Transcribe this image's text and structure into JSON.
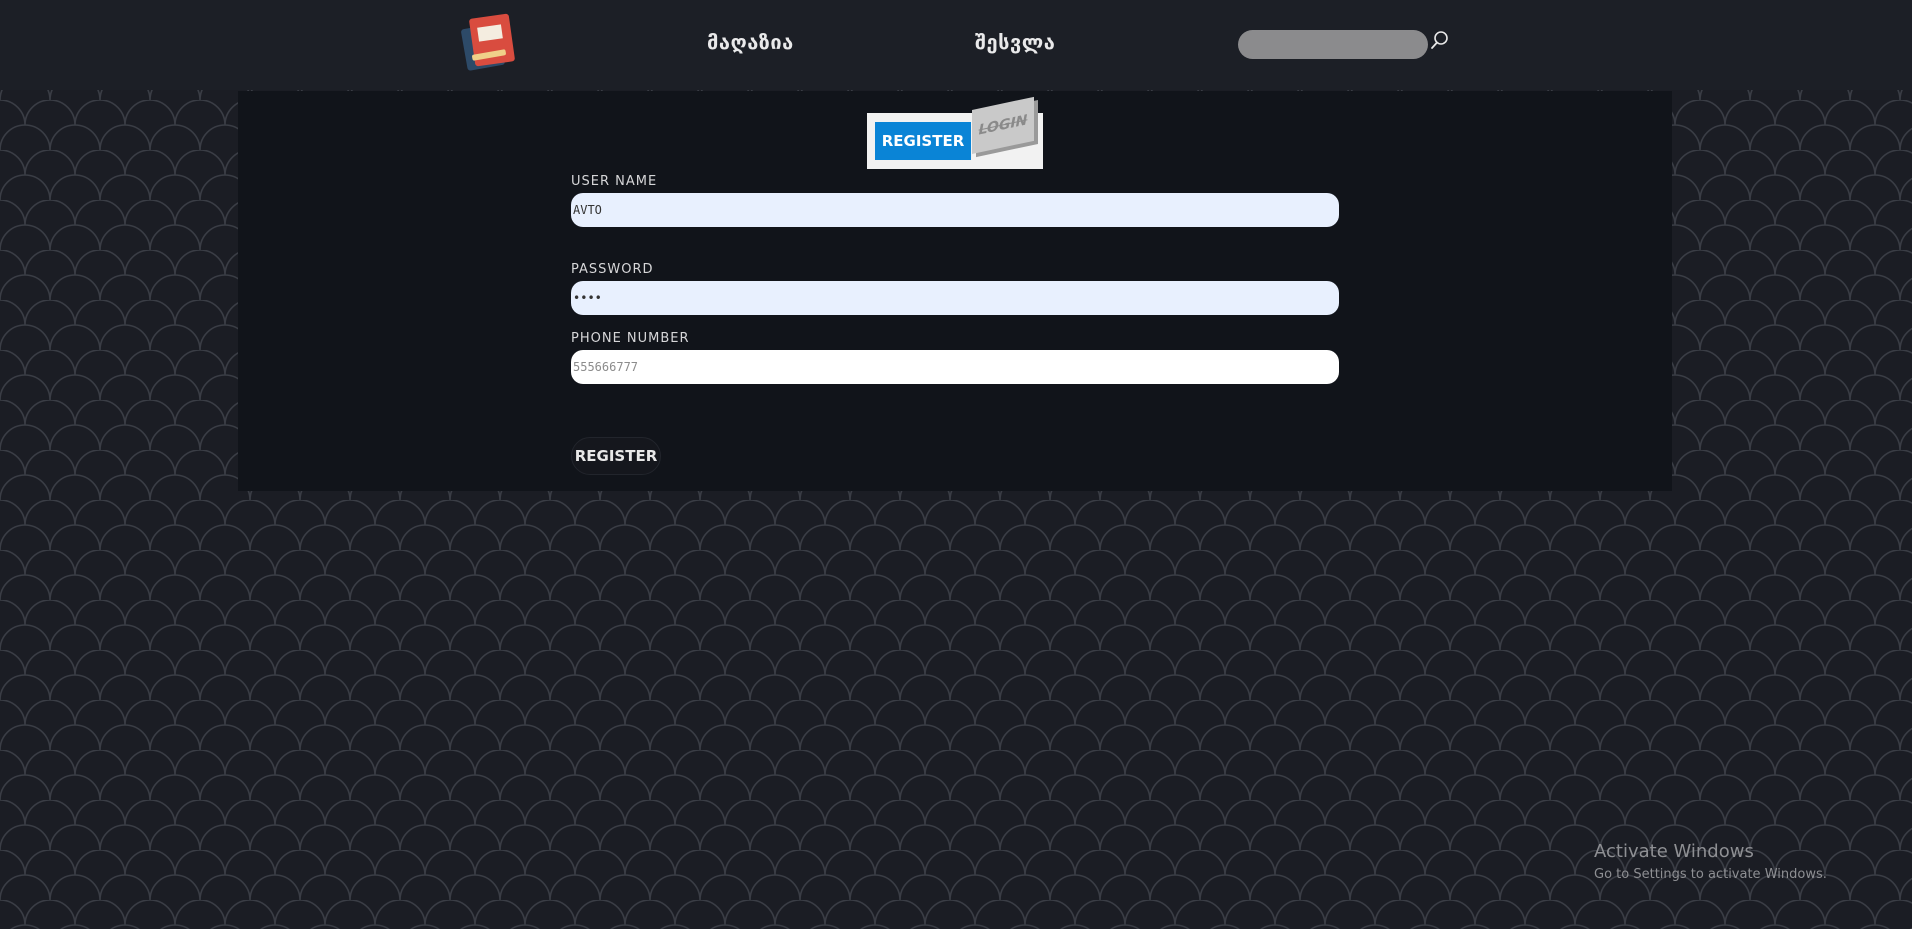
{
  "header": {
    "nav": [
      {
        "label": "მაღაზია"
      },
      {
        "label": "შესვლა"
      }
    ],
    "search": {
      "value": "",
      "placeholder": ""
    }
  },
  "auth_toggle": {
    "register_label": "REGISTER",
    "login_label": "LOGIN",
    "active": "register"
  },
  "form": {
    "username": {
      "label": "USER NAME",
      "value": "AVTO"
    },
    "password": {
      "label": "PASSWORD",
      "value": "••••"
    },
    "phone": {
      "label": "PHONE NUMBER",
      "value": "",
      "placeholder": "555666777"
    },
    "submit_label": "REGISTER"
  },
  "watermark": {
    "title": "Activate Windows",
    "subtitle": "Go to Settings to activate Windows."
  },
  "colors": {
    "background": "#1b1d24",
    "panel": "#11141a",
    "accent": "#0a84d6",
    "input_filled": "#e8f0fe"
  }
}
